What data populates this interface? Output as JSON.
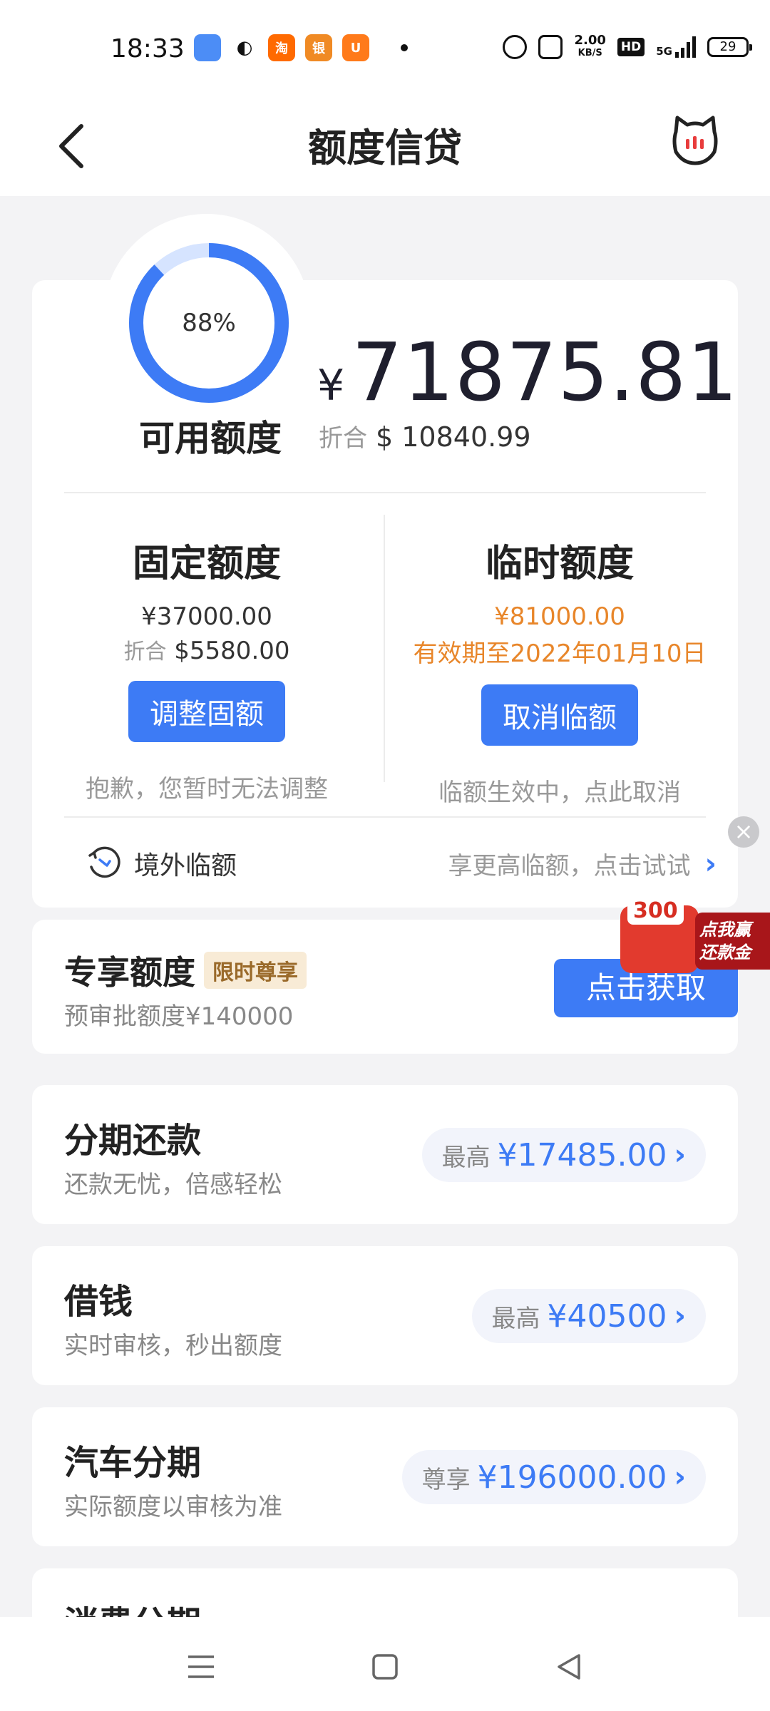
{
  "status": {
    "time": "18:33",
    "speed_top": "2.00",
    "speed_bottom": "KB/S",
    "hd": "HD",
    "net": "5G",
    "battery": "29"
  },
  "header": {
    "title": "额度信贷"
  },
  "credit": {
    "ring_percent": "88%",
    "ring_fraction": 0.88,
    "available_label": "可用额度",
    "currency": "¥",
    "available_amount": "71875.81",
    "converted_label": "折合",
    "converted_value": "$ 10840.99"
  },
  "fixed": {
    "title": "固定额度",
    "amount": "¥37000.00",
    "converted_label": "折合",
    "converted_value": "$5580.00",
    "button": "调整固额",
    "note": "抱歉，您暂时无法调整"
  },
  "temporary": {
    "title": "临时额度",
    "amount": "¥81000.00",
    "validity": "有效期至2022年01月10日",
    "button": "取消临额",
    "note": "临额生效中，点此取消"
  },
  "overseas": {
    "label": "境外临额",
    "promo": "享更高临额，点击试试",
    "chevron": "›"
  },
  "exclusive": {
    "title": "专享额度",
    "tag": "限时尊享",
    "subtitle": "预审批额度¥140000",
    "button": "点击获取"
  },
  "promo_float": {
    "amount": "300",
    "text": "点我赢还款金",
    "close": "×"
  },
  "loans": [
    {
      "title": "分期还款",
      "subtitle": "还款无忧，倍感轻松",
      "label": "最高",
      "amount": "¥17485.00",
      "chevron": "›"
    },
    {
      "title": "借钱",
      "subtitle": "实时审核，秒出额度",
      "label": "最高",
      "amount": "¥40500",
      "chevron": "›"
    },
    {
      "title": "汽车分期",
      "subtitle": "实际额度以审核为准",
      "label": "尊享",
      "amount": "¥196000.00",
      "chevron": "›"
    },
    {
      "title": "消费分期"
    }
  ],
  "colors": {
    "accent": "#3d7bf5",
    "orange": "#e8862a",
    "ring_track": "#d6e4ff"
  },
  "icons": {
    "back": "back-arrow-icon",
    "mascot": "cat-mascot-icon",
    "overseas": "plane-clock-icon",
    "nav_menu": "menu-icon",
    "nav_home": "home-square-icon",
    "nav_back": "triangle-back-icon"
  }
}
